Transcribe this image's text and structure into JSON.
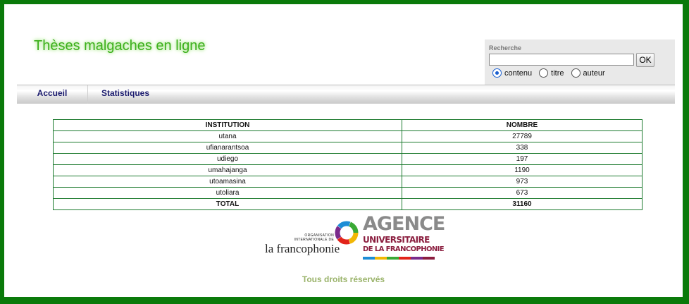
{
  "site": {
    "title": "Thèses malgaches en ligne"
  },
  "search": {
    "label": "Recherche",
    "value": "",
    "button_label": "OK",
    "options": [
      {
        "label": "contenu",
        "checked": true
      },
      {
        "label": "titre",
        "checked": false
      },
      {
        "label": "auteur",
        "checked": false
      }
    ]
  },
  "nav": {
    "items": [
      {
        "label": "Accueil"
      },
      {
        "label": "Statistiques"
      }
    ]
  },
  "stats_table": {
    "headers": [
      "INSTITUTION",
      "NOMBRE"
    ],
    "rows": [
      {
        "institution": "utana",
        "count": "27789"
      },
      {
        "institution": "ufianarantsoa",
        "count": "338"
      },
      {
        "institution": "udiego",
        "count": "197"
      },
      {
        "institution": "umahajanga",
        "count": "1190"
      },
      {
        "institution": "utoamasina",
        "count": "973"
      },
      {
        "institution": "utoliara",
        "count": "673"
      }
    ],
    "total": {
      "label": "TOTAL",
      "count": "31160"
    }
  },
  "logos": {
    "oif": {
      "small_text": "ORGANISATION INTERNATIONALE DE",
      "big_text": "la francophonie"
    },
    "auf": {
      "line1": "AGENCE",
      "line2": "UNIVERSITAIRE",
      "line3": "DE LA FRANCOPHONIE"
    }
  },
  "footer": {
    "text": "Tous droits réservés"
  },
  "colors": {
    "frame": "#0a7a0a",
    "title": "#3cb01c",
    "nav_text": "#1a1a6e",
    "table_border": "#1c7a2e",
    "footer": "#9ab36a",
    "auf_brand": "#8b1e3f"
  }
}
